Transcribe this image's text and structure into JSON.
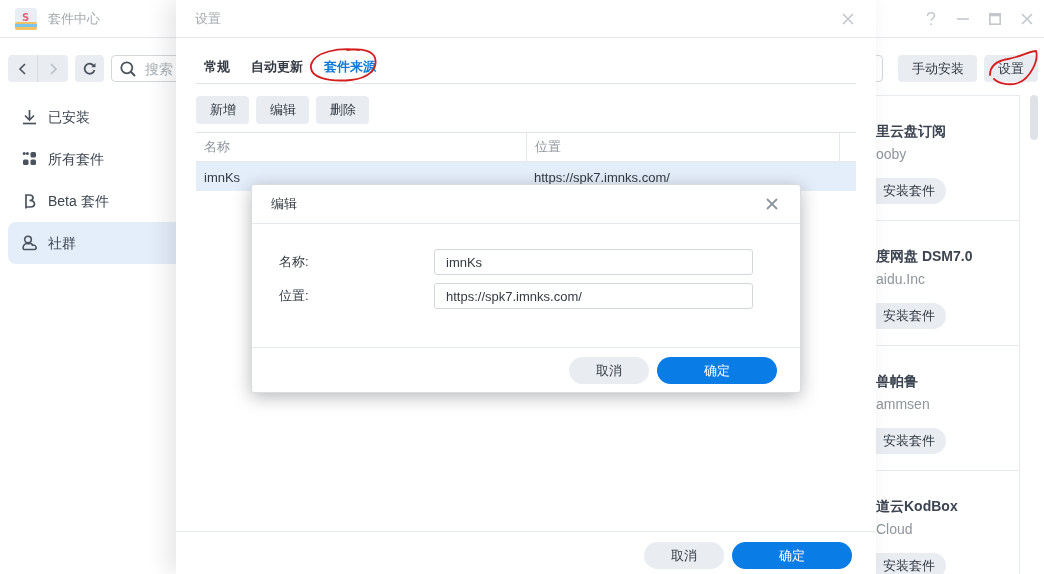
{
  "window": {
    "logo": "S",
    "title": "套件中心"
  },
  "toolbar": {
    "nav": [
      {
        "kind": "back",
        "disabled": false
      },
      {
        "kind": "forward",
        "disabled": true
      }
    ],
    "search": {
      "placeholder": "搜索"
    },
    "buttons": [
      "手动安装",
      "设置"
    ]
  },
  "sidebar": {
    "items": [
      {
        "label": "已安装",
        "kind": "download",
        "selected": false
      },
      {
        "label": "所有套件",
        "kind": "grid",
        "selected": false
      },
      {
        "label": "Beta 套件",
        "kind": "beta",
        "selected": false
      },
      {
        "label": "社群",
        "kind": "community",
        "selected": true
      }
    ]
  },
  "packages": [
    {
      "title": "里云盘订阅",
      "publisher": "ooby",
      "button": "安装套件"
    },
    {
      "title": "度网盘 DSM7.0",
      "publisher": "aidu.Inc",
      "button": "安装套件"
    },
    {
      "title": "兽帕鲁",
      "publisher": "ammsen",
      "button": "安装套件"
    },
    {
      "title": "道云KodBox",
      "publisher": "Cloud",
      "button": "安装套件"
    }
  ],
  "settings_dialog": {
    "title": "设置",
    "tabs": [
      {
        "label": "常规",
        "selected": false
      },
      {
        "label": "自动更新",
        "selected": false
      },
      {
        "label": "套件来源",
        "selected": true
      }
    ],
    "actions": [
      "新增",
      "编辑",
      "删除"
    ],
    "table": {
      "columns": [
        "名称",
        "位置"
      ],
      "rows": [
        {
          "cells": [
            "imnKs",
            "https://spk7.imnks.com/"
          ],
          "selected": true
        }
      ]
    },
    "buttons": [
      {
        "label": "取消",
        "kind": "secondary"
      },
      {
        "label": "确定",
        "kind": "primary"
      }
    ]
  },
  "edit_dialog": {
    "title": "编辑",
    "fields": [
      {
        "label": "名称:",
        "value": "imnKs"
      },
      {
        "label": "位置:",
        "value": "https://spk7.imnks.com/"
      }
    ],
    "buttons": [
      {
        "label": "取消",
        "kind": "secondary"
      },
      {
        "label": "确定",
        "kind": "primary"
      }
    ]
  }
}
